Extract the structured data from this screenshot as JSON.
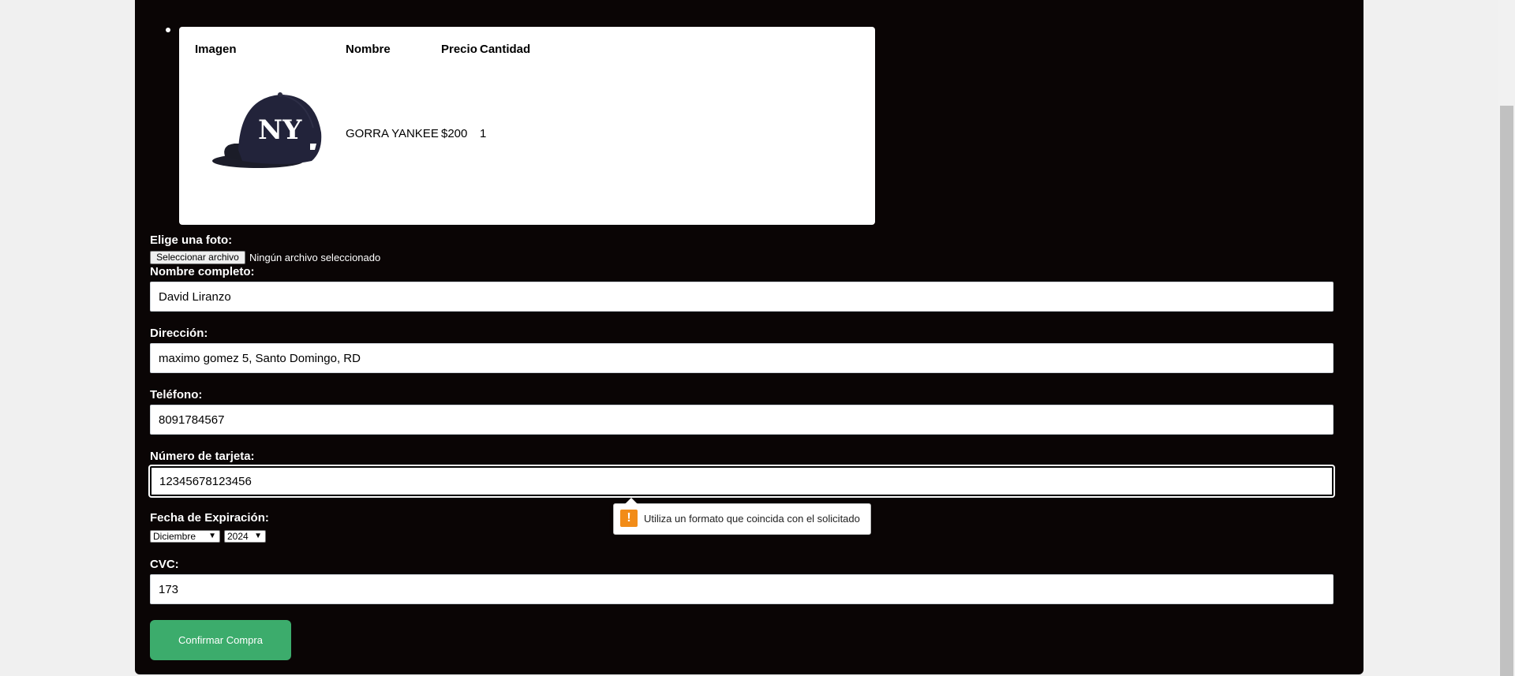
{
  "cart": {
    "headers": {
      "image": "Imagen",
      "name": "Nombre",
      "price": "Precio",
      "quantity": "Cantidad"
    },
    "items": [
      {
        "image": "yankees-cap-icon",
        "name": "GORRA YANKEE",
        "price": "$200",
        "quantity": "1"
      }
    ]
  },
  "photo": {
    "label": "Elige una foto:",
    "button": "Seleccionar archivo",
    "status": "Ningún archivo seleccionado"
  },
  "form": {
    "name_label": "Nombre completo:",
    "name_value": "David Liranzo",
    "address_label": "Dirección:",
    "address_value": "maximo gomez 5, Santo Domingo, RD",
    "phone_label": "Teléfono:",
    "phone_value": "8091784567",
    "card_label": "Número de tarjeta:",
    "card_value": "12345678123456",
    "expiry_label": "Fecha de Expiración:",
    "expiry_month": "Diciembre",
    "expiry_year": "2024",
    "cvc_label": "CVC:",
    "cvc_value": "173",
    "submit": "Confirmar Compra"
  },
  "validation": {
    "icon": "warning-icon",
    "message": "Utiliza un formato que coincida con el solicitado"
  },
  "colors": {
    "panel_bg": "#0a0505",
    "submit_bg": "#3cac6c",
    "warning": "#f28c18"
  }
}
